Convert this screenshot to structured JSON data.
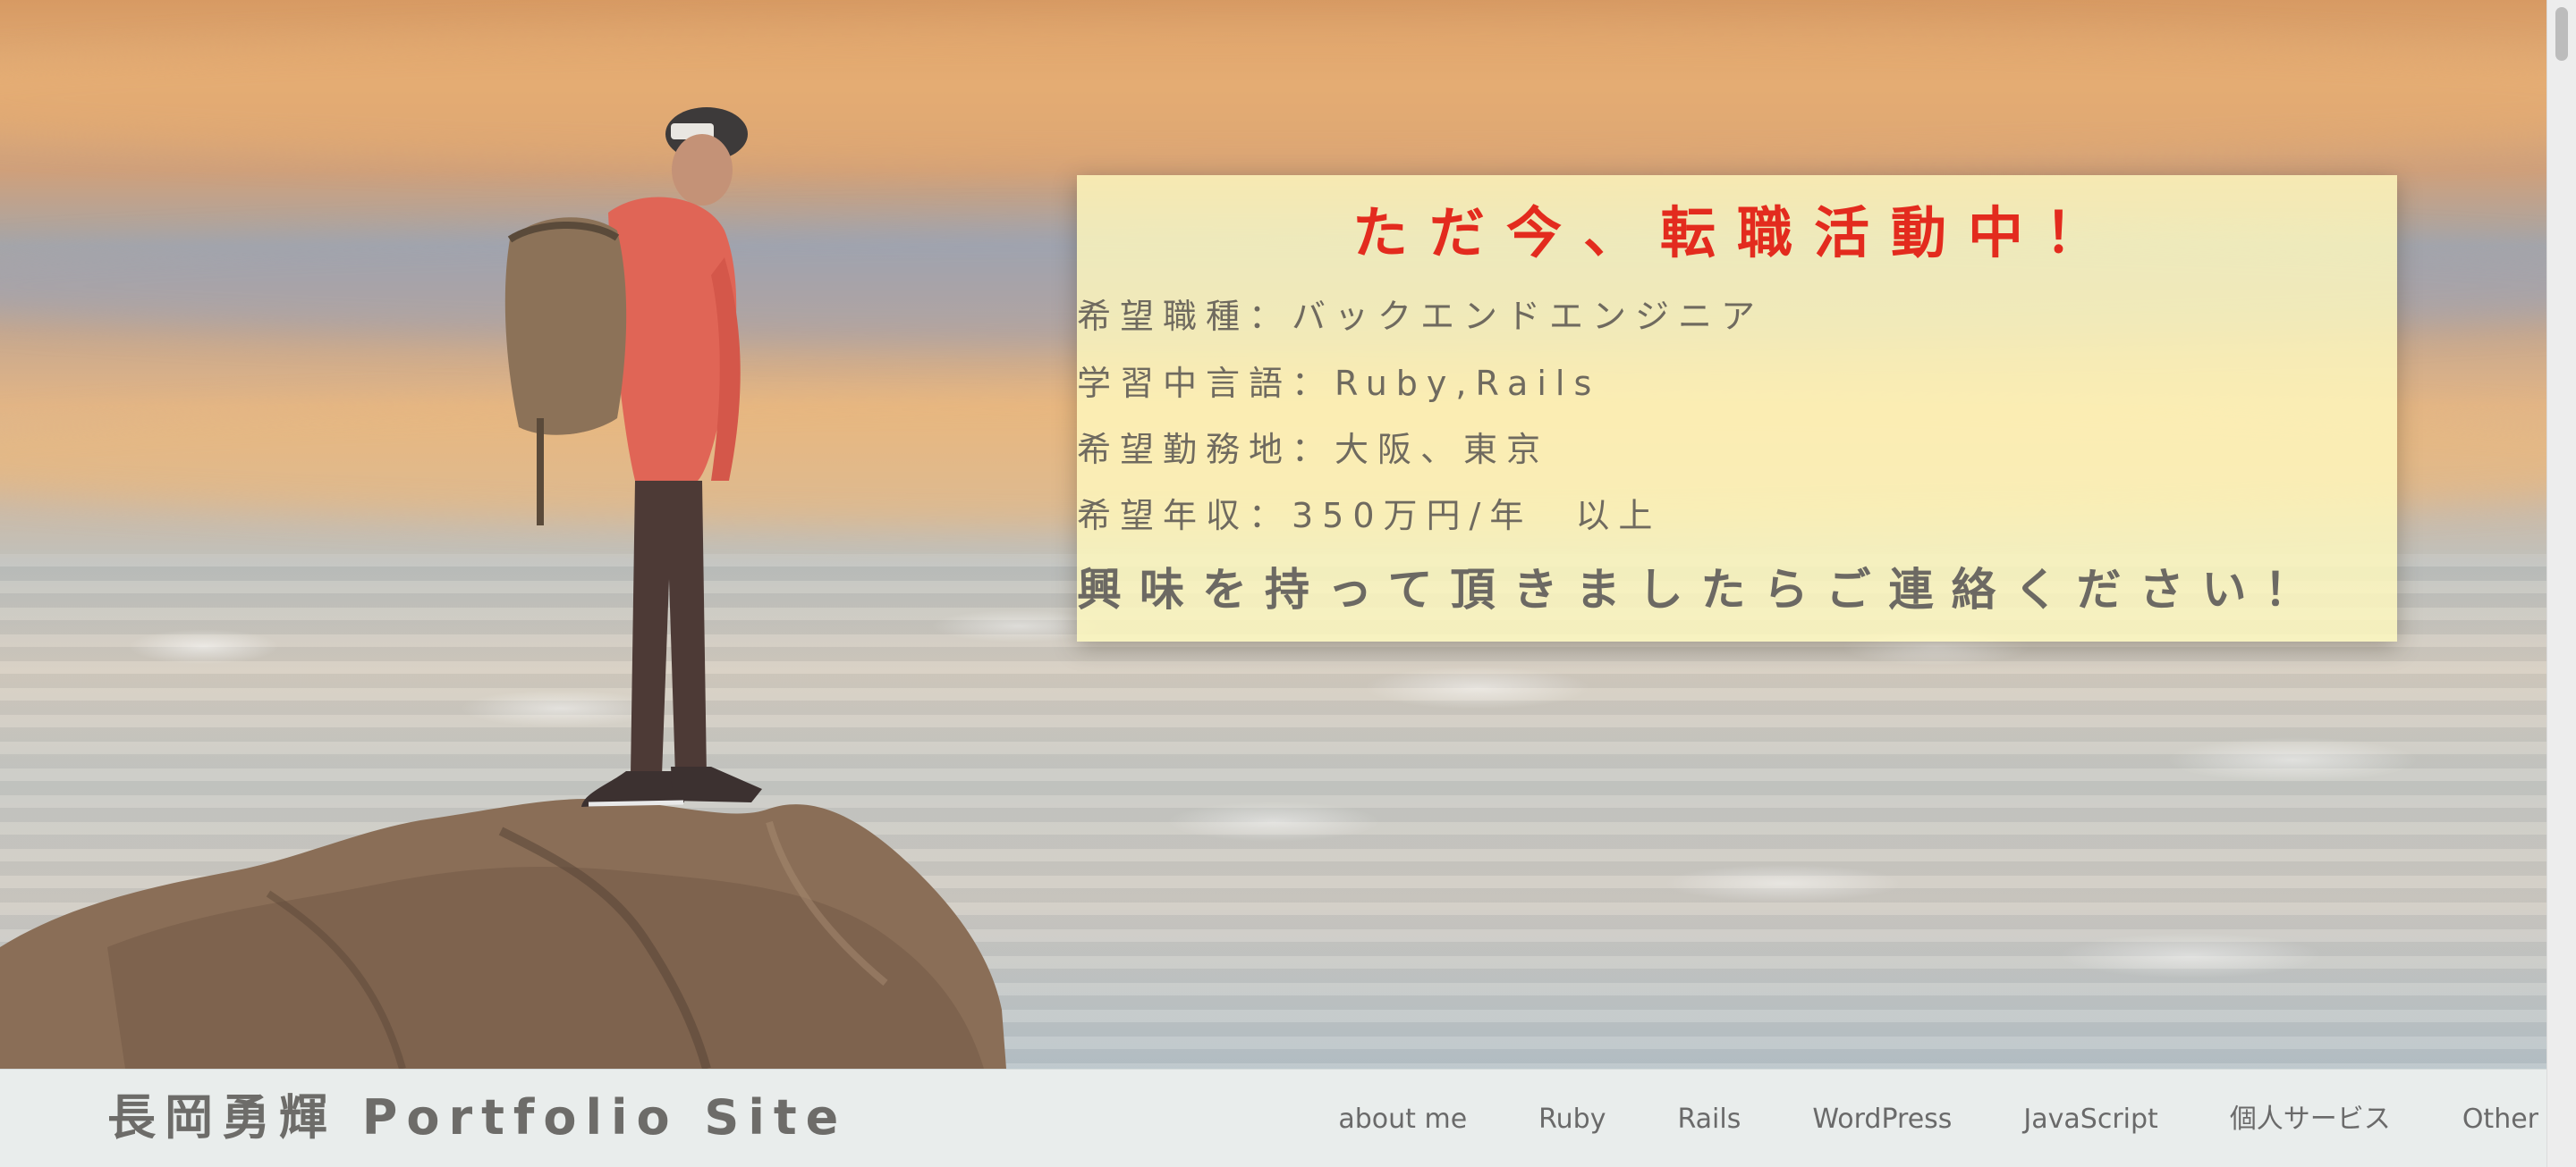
{
  "hero": {
    "headline": "ただ今、転職活動中！",
    "details": [
      "希望職種：バックエンドエンジニア",
      "学習中言語：Ruby,Rails",
      "希望勤務地：大阪、東京",
      "希望年収：350万円/年　以上"
    ],
    "cta": "興味を持って頂きましたらご連絡ください！",
    "headline_color": "#e32b1e",
    "card_color": "#fff9be"
  },
  "header": {
    "site_title": "長岡勇輝 Portfolio Site",
    "nav": [
      "about me",
      "Ruby",
      "Rails",
      "WordPress",
      "JavaScript",
      "個人サービス",
      "Other"
    ]
  }
}
